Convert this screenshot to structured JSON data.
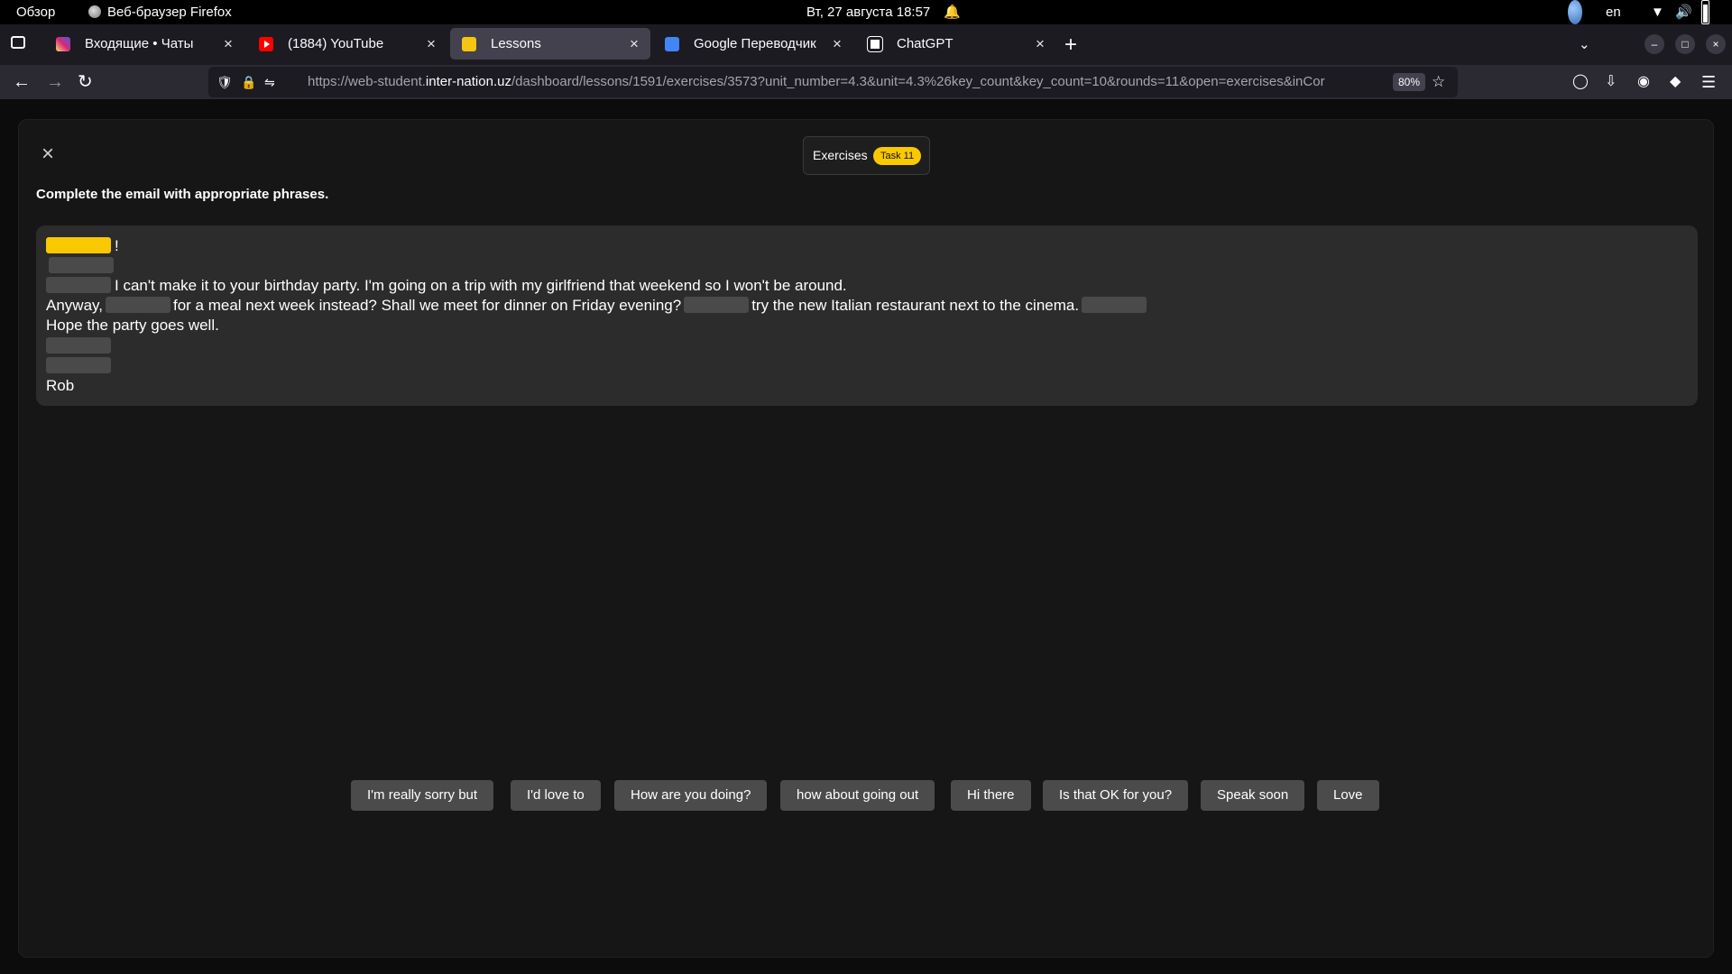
{
  "system_bar": {
    "overview": "Обзор",
    "app_name": "Веб-браузер Firefox",
    "clock": "Вт, 27 августа  18:57",
    "language": "en"
  },
  "browser": {
    "tabs": [
      {
        "title": "Входящие • Чаты",
        "active": false,
        "favicon": "instagram-icon"
      },
      {
        "title": "(1884) YouTube",
        "active": false,
        "favicon": "youtube-icon"
      },
      {
        "title": "Lessons",
        "active": true,
        "favicon": "lessons-icon"
      },
      {
        "title": "Google Переводчик",
        "active": false,
        "favicon": "google-translate-icon"
      },
      {
        "title": "ChatGPT",
        "active": false,
        "favicon": "chatgpt-icon"
      }
    ],
    "url_prefix": "https://web-student.",
    "url_host": "inter-nation.uz",
    "url_path": "/dashboard/lessons/1591/exercises/3573?unit_number=4.3&unit=4.3%26key_count&key_count=10&rounds=11&open=exercises&inCor",
    "zoom": "80%"
  },
  "exercise": {
    "header_label": "Exercises",
    "task_badge": "Task 11",
    "instruction": "Complete the email with appropriate phrases.",
    "email": {
      "greeting_punct": "!",
      "line3_text": "I can't make it to your birthday party. I'm going on a trip with my girlfriend that weekend so I won't be around.",
      "line4_start": "Anyway,",
      "line4_mid1": "for a meal next week instead? Shall we meet for dinner on Friday evening?",
      "line4_mid2": "try the new Italian restaurant next to the cinema.",
      "line5_text": "Hope the party goes well.",
      "signature": "Rob"
    },
    "phrases": [
      "I'm really sorry but",
      "I'd love to",
      "How are you doing?",
      "how about going out",
      "Hi there",
      "Is that OK for you?",
      "Speak soon",
      "Love"
    ]
  },
  "colors": {
    "accent": "#f9c800",
    "blank": "#4a4a4a",
    "email_bg": "#2c2c2c",
    "chip_bg": "#4b4b4b"
  }
}
